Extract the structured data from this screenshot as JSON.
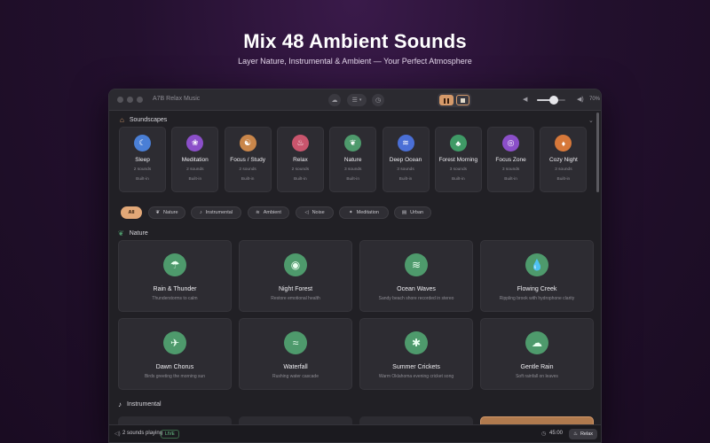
{
  "hero": {
    "title": "Mix 48 Ambient Sounds",
    "subtitle": "Layer Nature, Instrumental & Ambient — Your Perfect Atmosphere"
  },
  "window": {
    "app_title": "A7B Relax Music",
    "volume_percent": "70%",
    "volume_level": 0.7
  },
  "soundscapes": {
    "title": "Soundscapes",
    "items": [
      {
        "name": "Sleep",
        "count": "2 sounds",
        "tag": "Built-in",
        "icon": "moon-icon",
        "glyph": "☾",
        "color": "#4a7fd6"
      },
      {
        "name": "Meditation",
        "count": "2 sounds",
        "tag": "Built-in",
        "icon": "lotus-icon",
        "glyph": "❀",
        "color": "#8b4fc9"
      },
      {
        "name": "Focus / Study",
        "count": "2 sounds",
        "tag": "Built-in",
        "icon": "brain-icon",
        "glyph": "☯",
        "color": "#c9864a"
      },
      {
        "name": "Relax",
        "count": "2 sounds",
        "tag": "Built-in",
        "icon": "spa-icon",
        "glyph": "♨",
        "color": "#c9556d"
      },
      {
        "name": "Nature",
        "count": "3 sounds",
        "tag": "Built-in",
        "icon": "leaf-icon",
        "glyph": "❦",
        "color": "#4e9a6c"
      },
      {
        "name": "Deep Ocean",
        "count": "3 sounds",
        "tag": "Built-in",
        "icon": "waves-icon",
        "glyph": "≋",
        "color": "#4a6fd6"
      },
      {
        "name": "Forest Morning",
        "count": "3 sounds",
        "tag": "Built-in",
        "icon": "tree-icon",
        "glyph": "♣",
        "color": "#3f9a66"
      },
      {
        "name": "Focus Zone",
        "count": "3 sounds",
        "tag": "Built-in",
        "icon": "target-icon",
        "glyph": "◎",
        "color": "#8b4fc9"
      },
      {
        "name": "Cozy Night",
        "count": "3 sounds",
        "tag": "Built-in",
        "icon": "fire-icon",
        "glyph": "♦",
        "color": "#d6783a"
      }
    ]
  },
  "filters": [
    {
      "label": "All",
      "glyph": "",
      "active": true
    },
    {
      "label": "Nature",
      "glyph": "❦",
      "active": false
    },
    {
      "label": "Instrumental",
      "glyph": "♪",
      "active": false
    },
    {
      "label": "Ambient",
      "glyph": "≋",
      "active": false
    },
    {
      "label": "Noise",
      "glyph": "◁",
      "active": false
    },
    {
      "label": "Meditation",
      "glyph": "✦",
      "active": false
    },
    {
      "label": "Urban",
      "glyph": "▤",
      "active": false
    }
  ],
  "nature": {
    "title": "Nature",
    "sounds": [
      {
        "name": "Rain & Thunder",
        "desc": "Thunderstorms to calm",
        "icon": "cloud-rain-icon",
        "glyph": "☂"
      },
      {
        "name": "Night Forest",
        "desc": "Restore emotional health",
        "icon": "night-forest-icon",
        "glyph": "◉"
      },
      {
        "name": "Ocean Waves",
        "desc": "Sandy beach shore recorded in stereo",
        "icon": "waves-icon",
        "glyph": "≋"
      },
      {
        "name": "Flowing Creek",
        "desc": "Rippling brook with hydrophone clarity",
        "icon": "water-drop-icon",
        "glyph": "💧"
      },
      {
        "name": "Dawn Chorus",
        "desc": "Birds greeting the morning sun",
        "icon": "bird-icon",
        "glyph": "✈"
      },
      {
        "name": "Waterfall",
        "desc": "Rushing water cascade",
        "icon": "waterfall-icon",
        "glyph": "≈"
      },
      {
        "name": "Summer Crickets",
        "desc": "Warm Oklahoma evening cricket song",
        "icon": "cricket-icon",
        "glyph": "✱"
      },
      {
        "name": "Gentle Rain",
        "desc": "Soft rainfall on leaves",
        "icon": "cloud-drizzle-icon",
        "glyph": "☁"
      }
    ]
  },
  "instrumental": {
    "title": "Instrumental"
  },
  "bottom": {
    "playing": "2 sounds playing",
    "live": "LIVE",
    "timer": "45:00",
    "scene": "Relax"
  }
}
